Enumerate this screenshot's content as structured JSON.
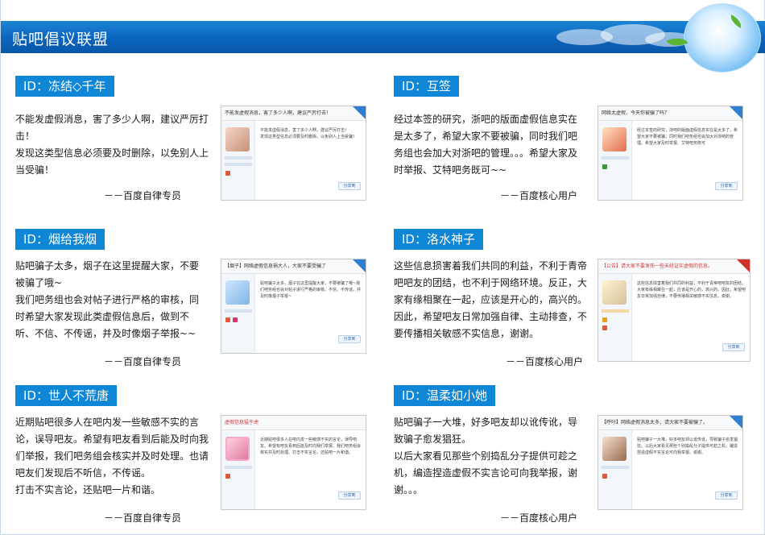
{
  "header": {
    "title": "贴吧倡议联盟"
  },
  "colors": {
    "banner": "#0a64bd",
    "tag": "#0f86d6"
  },
  "cards": [
    {
      "tag": "ID：冻结◇千年",
      "body": "不能发虚假消息，害了多少人啊，建议严厉打击！\n发现这类型信息必须要及时删除，以免别人上当受骗！",
      "sign": "－－百度自律专员",
      "thumb_title": "不能发虚假消息，害了多少人啊，建议严厉打击！",
      "thumb_text": "不能发虚假消息，害了多少人啊，建议严厉打击！\n发现这类型信息必须要及时删除，以免别人上当受骗！",
      "thumb_btn": "分享到"
    },
    {
      "tag": "ID：互签",
      "body": "经过本签的研究，浙吧的版面虚假信息实在是太多了，希望大家不要被骗，同时我们吧务组也会加大对浙吧的管理。。。希望大家及时举报、艾特吧务既可~~",
      "sign": "－－百度核心用户",
      "thumb_title": "网络太虚假，今天你被骗了吗？",
      "thumb_text": "经过本签的研究，浙吧的版面虚假信息实在是太多了，希望大家不要被骗，同时我们吧务组也会加大对浙吧的管理。希望大家及时举报、艾特吧务既可",
      "thumb_btn": "分享到"
    },
    {
      "tag": "ID：烟给我烟",
      "body": "贴吧骗子太多，烟子在这里提醒大家，不要被骗了哦~\n我们吧务组也会对帖子进行严格的审核，同时希望大家发现此类虚假信息后，做到不听、不信、不传谣，并及时像烟子举报~~",
      "sign": "－－百度自律专员",
      "thumb_title": "【烟子】网络虚假信息祸大人，大家不要受骗了",
      "thumb_text": "贴吧骗子太多，烟子在这里提醒大家，不要被骗了哦~我们吧务组也会对帖子进行严格的审核。不信、不传谣，并及时像烟子举报~",
      "thumb_btn": "分享到"
    },
    {
      "tag": "ID：洛水神子",
      "body": "这些信息损害着我们共同的利益，不利于青帝吧吧友的团结，也不利于网络环境。反正，大家有缘相聚在一起，应该是开心的，高兴的。因此，希望吧友日常加强自律、主动排查，不要传播相关敏感不实信息，谢谢。",
      "sign": "－－百度核心用户",
      "thumb_title": "【公告】请大家不要发布一些未经证实虚假的信息。",
      "thumb_text": "这些信息损害着我们共同的利益，不利于青帝吧吧友的团结，大家有缘相聚在一起，应该是开心的，高兴的。因此，希望吧友日常加强自律，不要传播相关敏感不实信息，谢谢。",
      "thumb_btn": "分享到"
    },
    {
      "tag": "ID：世人不荒唐",
      "body": "近期贴吧很多人在吧内发一些敏感不实的言论，误导吧友。希望有吧友看到后能及时向我们举报，我们吧务组会核实并及时处理。也请吧友们发现后不听信，不传谣。\n打击不实言论，还贴吧一片和谐。",
      "sign": "－－百度自律专员",
      "thumb_title": "虚假信息猛于虎",
      "thumb_text": "近期贴吧很多人在吧内发一些敏感不实的言论，误导吧友。希望有吧友看到后能及时向我们举报，我们吧务组会核实并及时处理。打击不实言论，还贴吧一片和谐。",
      "thumb_btn": "分享到"
    },
    {
      "tag": "ID：温柔如小她",
      "body": "贴吧骗子一大堆，好多吧友却以讹传讹，导致骗子愈发猖狂。\n以后大家看见那些个别捣乱分子提供可趁之机，编造捏造虚假不实言论可向我举报，谢谢。。。",
      "sign": "－－百度核心用户",
      "thumb_title": "【呼吁】网络虚假消息太多，请大家不要被骗了。",
      "thumb_text": "贴吧骗子一大堆，好多吧友却以讹传讹，导致骗子愈发猖狂。以后大家看见那些个别捣乱分子提供可趁之机，编造捏造虚假不实言论可向我举报，谢谢。",
      "thumb_btn": "分享到"
    }
  ]
}
